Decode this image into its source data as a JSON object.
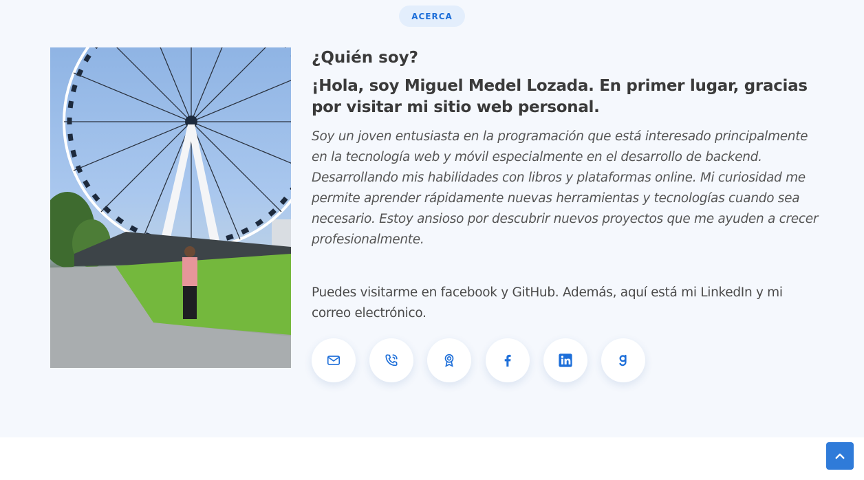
{
  "section": {
    "label": "ACERCA"
  },
  "about": {
    "heading": "¿Quién soy?",
    "greeting": "¡Hola, soy Miguel Medel Lozada. En primer lugar, gracias por visitar mi sitio web personal.",
    "bio": "Soy un joven entusiasta en la programación que está interesado principalmente en la tecnología web y móvil especialmente en el desarrollo de backend. Desarrollando mis habilidades con libros y plataformas online. Mi curiosidad me permite aprender rápidamente nuevas herramientas y tecnologías cuando sea necesario. Estoy ansioso por descubrir nuevos proyectos que me ayuden a crecer profesionalmente.",
    "visit": "Puedes visitarme en facebook y GitHub. Además, aquí está mi LinkedIn y mi correo electrónico."
  },
  "socials": [
    {
      "icon": "mail-icon"
    },
    {
      "icon": "phone-icon"
    },
    {
      "icon": "award-icon"
    },
    {
      "icon": "facebook-icon"
    },
    {
      "icon": "linkedin-icon"
    },
    {
      "icon": "goodreads-icon"
    }
  ],
  "colors": {
    "accent": "#1e6fd9",
    "section_bg": "#f5f8fd",
    "pill_bg": "#e3eefc",
    "to_top_bg": "#2f7bd9"
  }
}
